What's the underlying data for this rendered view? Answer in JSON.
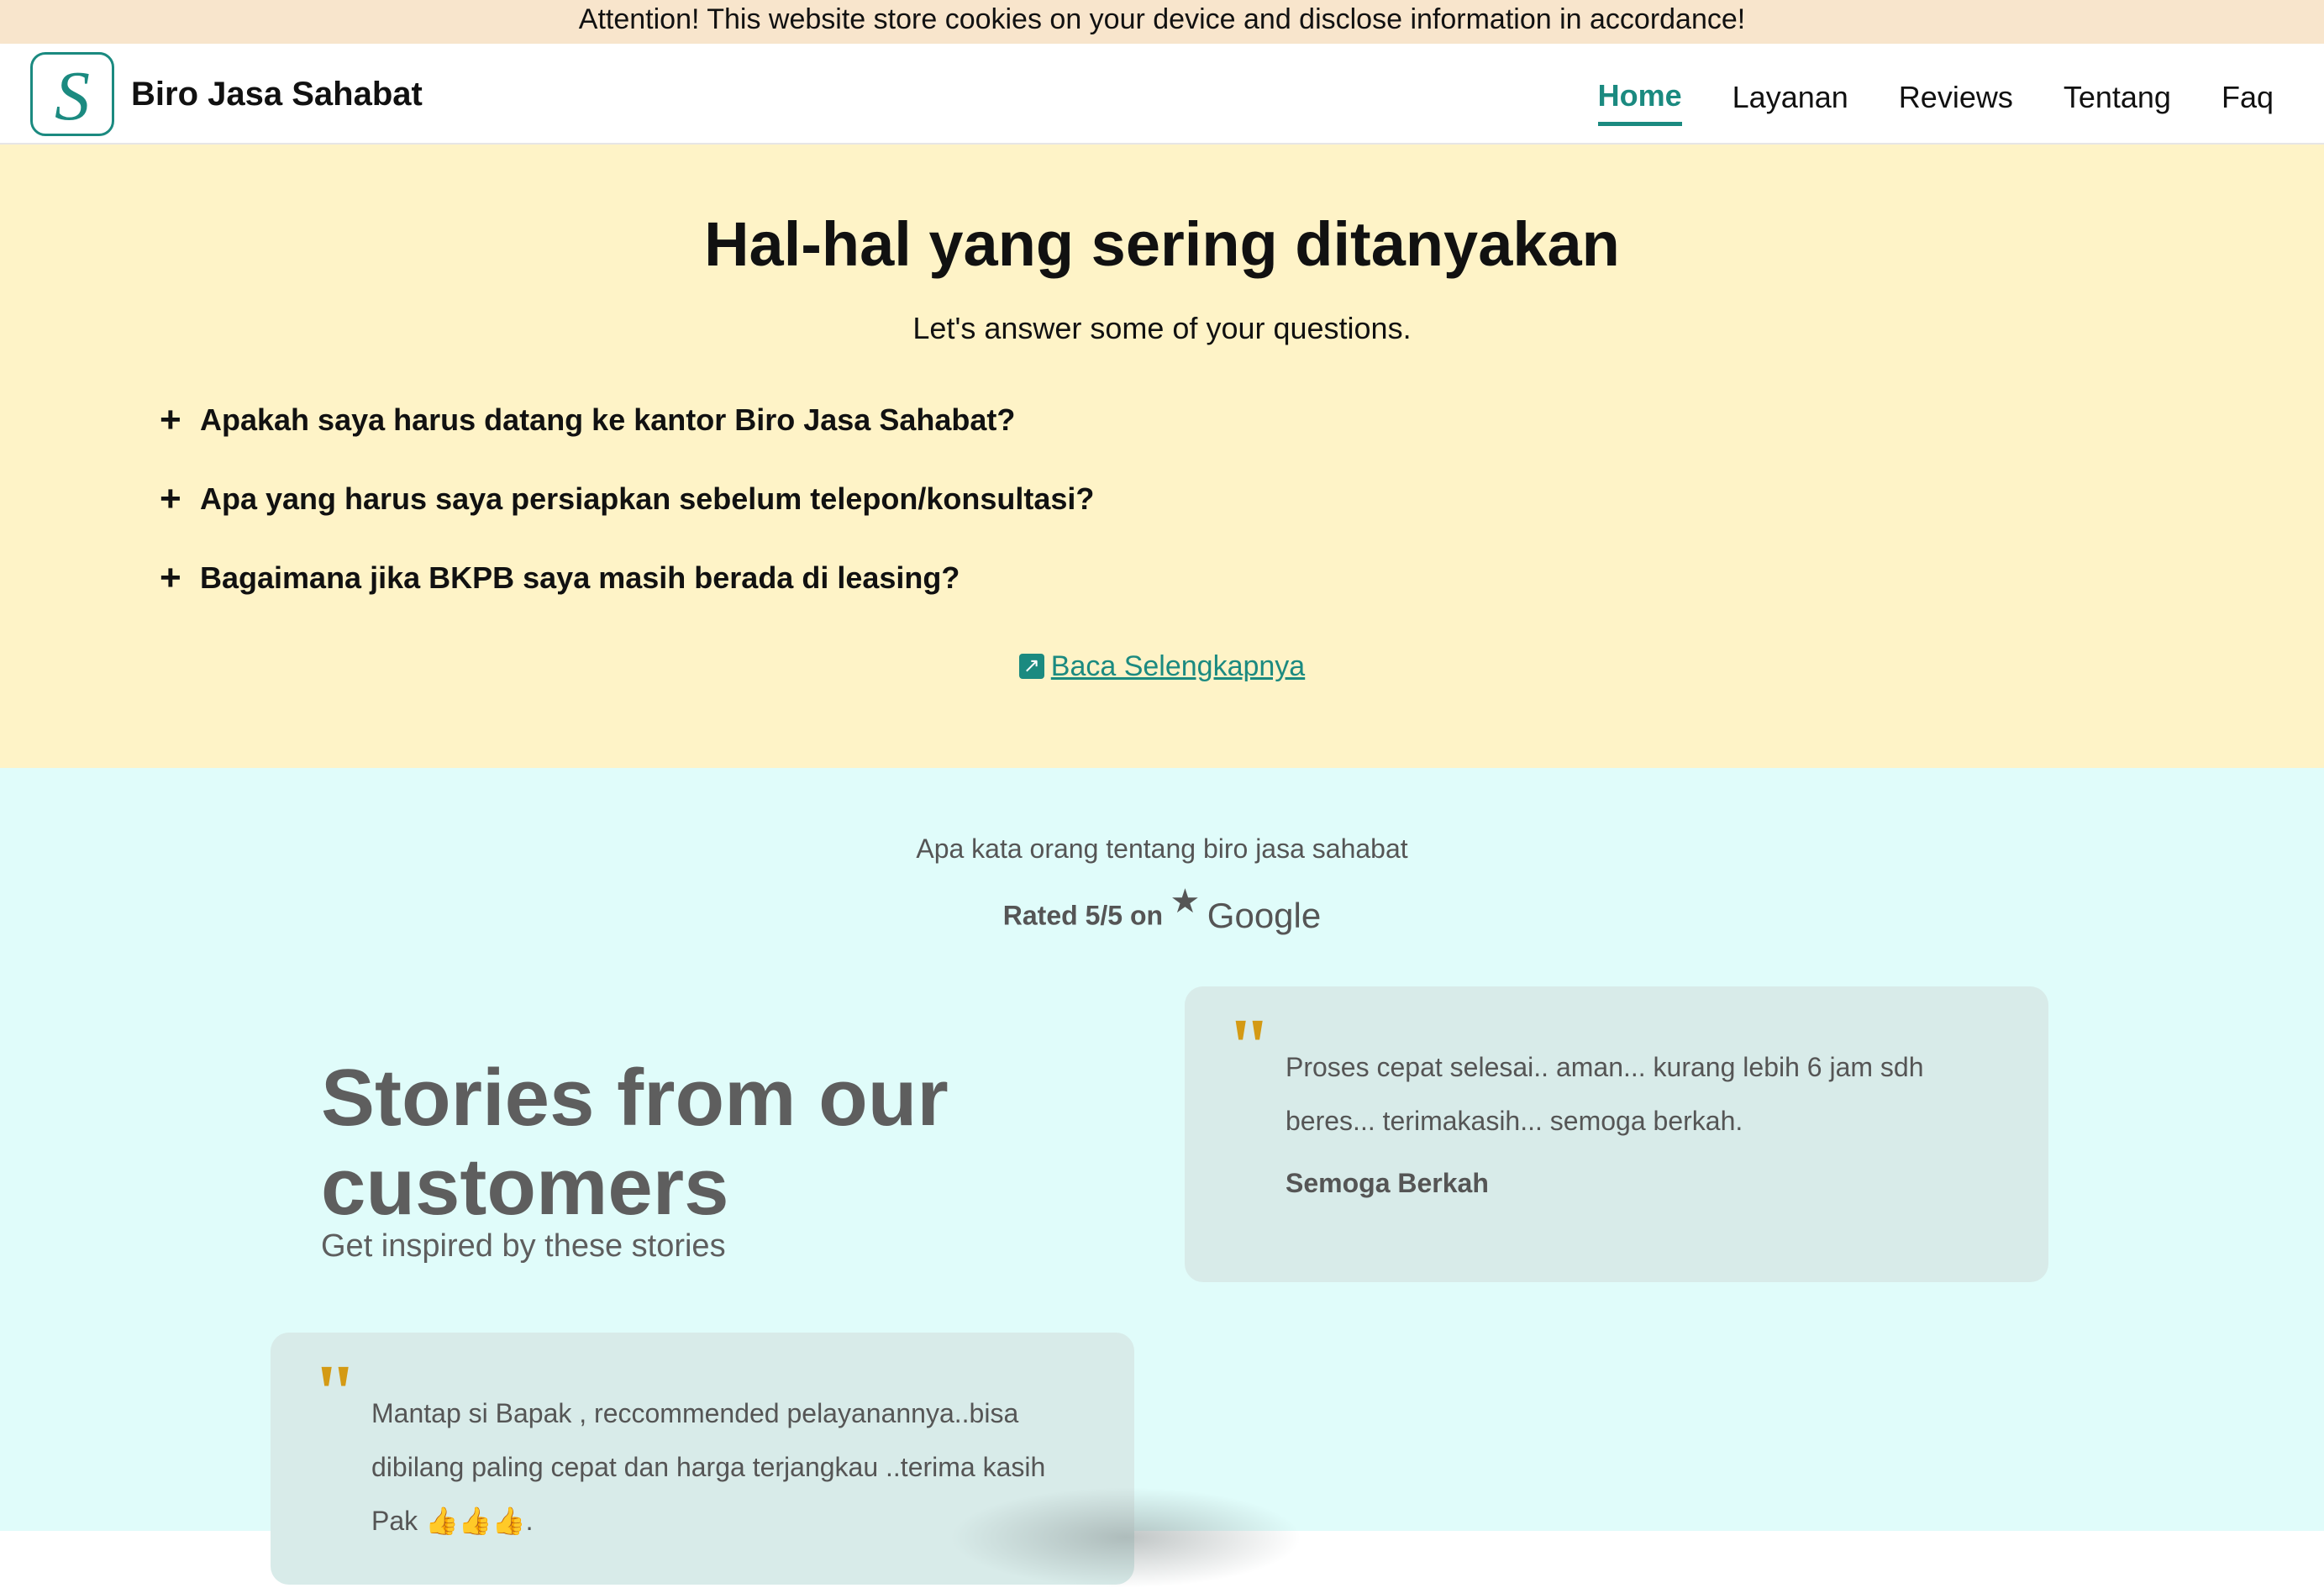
{
  "cookie_banner": {
    "text": "Attention! This website store cookies on your device and disclose information in accordance!"
  },
  "header": {
    "logo_letter": "S",
    "brand": "Biro Jasa Sahabat",
    "nav": [
      {
        "label": "Home",
        "active": true
      },
      {
        "label": "Layanan",
        "active": false
      },
      {
        "label": "Reviews",
        "active": false
      },
      {
        "label": "Tentang",
        "active": false
      },
      {
        "label": "Faq",
        "active": false
      }
    ]
  },
  "faq": {
    "title": "Hal-hal yang sering ditanyakan",
    "subtitle": "Let's answer some of your questions.",
    "items": [
      {
        "icon": "+",
        "question": "Apakah saya harus datang ke kantor Biro Jasa Sahabat?"
      },
      {
        "icon": "+",
        "question": "Apa yang harus saya persiapkan sebelum telepon/konsultasi?"
      },
      {
        "icon": "+",
        "question": "Bagaimana jika BKPB saya masih berada di leasing?"
      }
    ],
    "read_more": "Baca Selengkapnya",
    "read_more_icon": "external-link-icon"
  },
  "reviews": {
    "tagline": "Apa kata orang tentang biro jasa sahabat",
    "rating_text": "Rated 5/5 on",
    "rating_icon": "star-icon",
    "rating_source": "Google",
    "heading": "Stories from our customers",
    "subheading": "Get inspired by these stories",
    "cards": [
      {
        "quote_mark": "\"",
        "text": "Proses cepat selesai.. aman... kurang lebih 6 jam sdh beres... terimakasih... semoga berkah.",
        "author": "Semoga Berkah"
      },
      {
        "quote_mark": "\"",
        "text": "Mantap si Bapak , reccommended pelayanannya..bisa dibilang paling cepat dan harga terjangkau ..terima kasih Pak 👍👍👍.",
        "author": ""
      }
    ]
  },
  "colors": {
    "accent": "#1b8a80",
    "cookie_bg": "#f8e5cc",
    "faq_bg": "#fef3c7",
    "reviews_bg": "#e0fcfa",
    "card_bg": "#d8ebe9",
    "quote_color": "#d49a14"
  }
}
